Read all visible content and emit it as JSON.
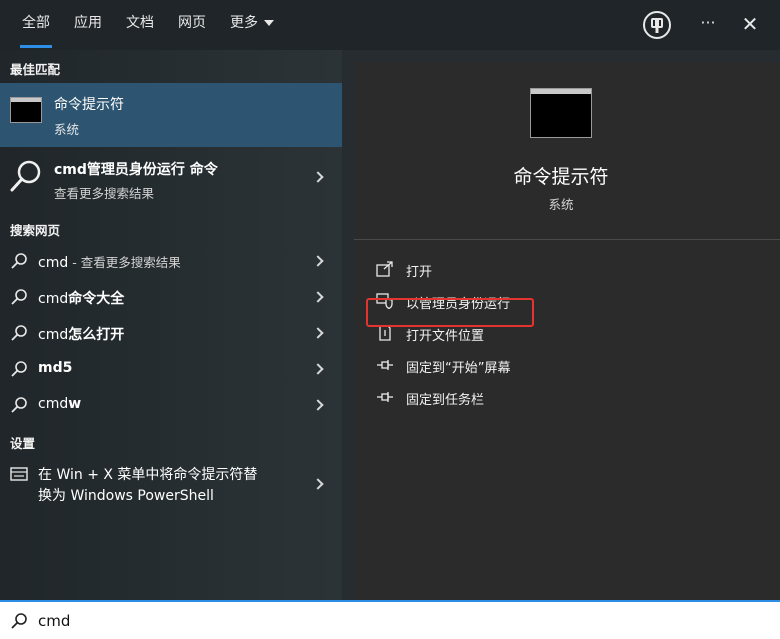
{
  "tabs": [
    {
      "label": "全部",
      "active": true
    },
    {
      "label": "应用"
    },
    {
      "label": "文档"
    },
    {
      "label": "网页"
    },
    {
      "label": "更多"
    }
  ],
  "top_icons": [
    "feedback-icon",
    "more-options-icon",
    "close-icon"
  ],
  "more_icon_text": "···",
  "close_icon_text": "✕",
  "sections": {
    "best_match": "最佳匹配",
    "search_web": "搜索网页",
    "settings": "设置"
  },
  "best_match": {
    "title": "命令提示符",
    "subtitle": "系统"
  },
  "admin_suggestion": {
    "title": "cmd管理员身份运行 命令",
    "subtitle": "查看更多搜索结果"
  },
  "web_results": [
    {
      "prefix": "cmd",
      "suffix": " - 查看更多搜索结果",
      "suffix_bold": false
    },
    {
      "prefix": "cmd",
      "suffix": "命令大全",
      "suffix_bold": true
    },
    {
      "prefix": "cmd",
      "suffix": "怎么打开",
      "suffix_bold": true
    },
    {
      "prefix": "md5",
      "suffix": "",
      "prefix_bold": true
    },
    {
      "prefix": "cmd",
      "suffix": "w",
      "suffix_bold": true
    }
  ],
  "setting_item": {
    "line1": "在 Win + X 菜单中将命令提示符替",
    "line2": "换为 Windows PowerShell"
  },
  "detail": {
    "title": "命令提示符",
    "subtitle": "系统",
    "actions": [
      {
        "label": "打开",
        "icon": "open-icon"
      },
      {
        "label": "以管理员身份运行",
        "icon": "shield-admin-icon",
        "highlighted": true
      },
      {
        "label": "打开文件位置",
        "icon": "file-location-icon"
      },
      {
        "label": "固定到“开始”屏幕",
        "icon": "pin-icon"
      },
      {
        "label": "固定到任务栏",
        "icon": "pin-icon"
      }
    ]
  },
  "search": {
    "value": "cmd"
  },
  "colors": {
    "accent": "#2e8ee6",
    "selected_row": "#2d5572",
    "highlight_box": "#e3342f"
  }
}
